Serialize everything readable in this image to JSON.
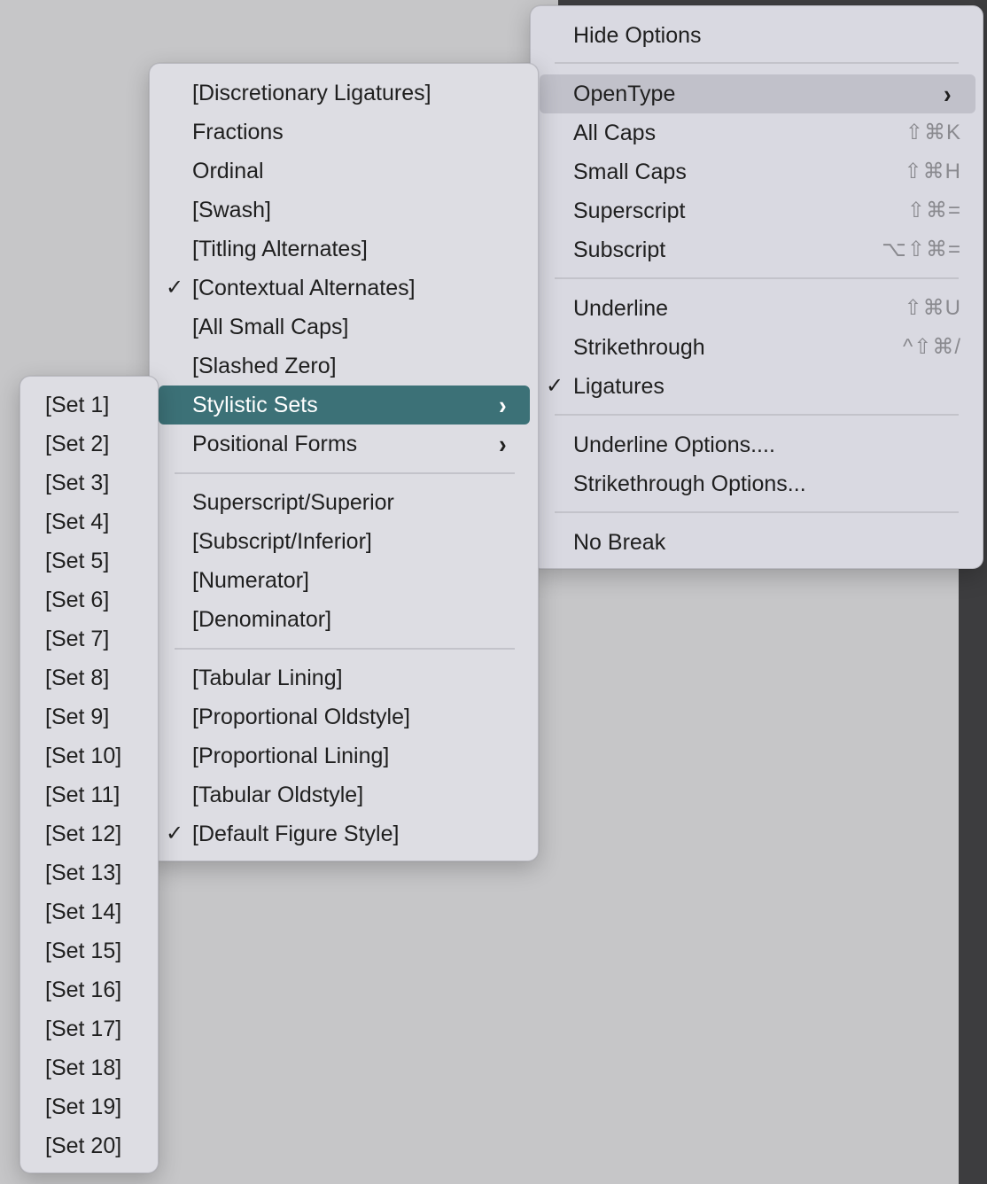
{
  "main_menu": {
    "items": [
      {
        "label": "Hide Options",
        "shortcut": "",
        "checked": false
      },
      {
        "label": "OpenType",
        "shortcut": "",
        "checked": false,
        "submenu": true
      },
      {
        "label": "All Caps",
        "shortcut": "⇧⌘K",
        "checked": false
      },
      {
        "label": "Small Caps",
        "shortcut": "⇧⌘H",
        "checked": false
      },
      {
        "label": "Superscript",
        "shortcut": "⇧⌘=",
        "checked": false
      },
      {
        "label": "Subscript",
        "shortcut": "⌥⇧⌘=",
        "checked": false
      },
      {
        "label": "Underline",
        "shortcut": "⇧⌘U",
        "checked": false
      },
      {
        "label": "Strikethrough",
        "shortcut": "^⇧⌘/",
        "checked": false
      },
      {
        "label": "Ligatures",
        "shortcut": "",
        "checked": true
      },
      {
        "label": "Underline Options....",
        "shortcut": "",
        "checked": false
      },
      {
        "label": "Strikethrough Options...",
        "shortcut": "",
        "checked": false
      },
      {
        "label": "No Break",
        "shortcut": "",
        "checked": false
      }
    ]
  },
  "opentype_menu": {
    "items": [
      {
        "label": "[Discretionary Ligatures]",
        "checked": false
      },
      {
        "label": "Fractions",
        "checked": false
      },
      {
        "label": "Ordinal",
        "checked": false
      },
      {
        "label": "[Swash]",
        "checked": false
      },
      {
        "label": "[Titling Alternates]",
        "checked": false
      },
      {
        "label": "[Contextual Alternates]",
        "checked": true
      },
      {
        "label": "[All Small Caps]",
        "checked": false
      },
      {
        "label": "[Slashed Zero]",
        "checked": false
      },
      {
        "label": "Stylistic Sets",
        "checked": false,
        "submenu": true
      },
      {
        "label": "Positional Forms",
        "checked": false,
        "submenu": true
      },
      {
        "label": "Superscript/Superior",
        "checked": false
      },
      {
        "label": "[Subscript/Inferior]",
        "checked": false
      },
      {
        "label": "[Numerator]",
        "checked": false
      },
      {
        "label": "[Denominator]",
        "checked": false
      },
      {
        "label": "[Tabular Lining]",
        "checked": false
      },
      {
        "label": "[Proportional Oldstyle]",
        "checked": false
      },
      {
        "label": "[Proportional Lining]",
        "checked": false
      },
      {
        "label": "[Tabular Oldstyle]",
        "checked": false
      },
      {
        "label": "[Default Figure Style]",
        "checked": true
      }
    ]
  },
  "stylistic_sets_menu": {
    "items": [
      "[Set 1]",
      "[Set 2]",
      "[Set 3]",
      "[Set 4]",
      "[Set 5]",
      "[Set 6]",
      "[Set 7]",
      "[Set 8]",
      "[Set 9]",
      "[Set 10]",
      "[Set 11]",
      "[Set 12]",
      "[Set 13]",
      "[Set 14]",
      "[Set 15]",
      "[Set 16]",
      "[Set 17]",
      "[Set 18]",
      "[Set 19]",
      "[Set 20]"
    ]
  },
  "glyphs": {
    "check": "✓",
    "chevron": "›"
  },
  "colors": {
    "selected": "#3c7177",
    "hover": "#c1c1ca",
    "menu_bg": "#dddde3"
  }
}
